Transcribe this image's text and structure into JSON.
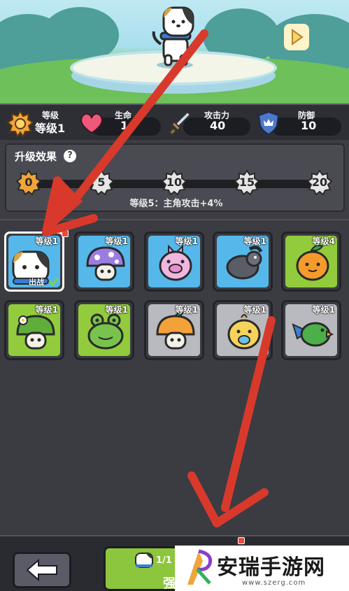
{
  "stats": {
    "level_caption": "等级",
    "level_value": "等级1",
    "hp_caption": "生命",
    "hp_value": "1",
    "attack_caption": "攻击力",
    "attack_value": "40",
    "defense_caption": "防御",
    "defense_value": "10"
  },
  "upgrade": {
    "title": "升级效果",
    "help": "?",
    "milestones": [
      "0",
      "5",
      "10",
      "15",
      "20"
    ],
    "effect_text": "等级5：主角攻击+4%"
  },
  "pets": [
    {
      "level": "等级1",
      "color": "blue",
      "selected": true,
      "deploy_label": "出战",
      "icon": "dog-icon"
    },
    {
      "level": "等级1",
      "color": "blue",
      "icon": "purple-mushroom-icon"
    },
    {
      "level": "等级1",
      "color": "blue",
      "icon": "pink-pig-icon"
    },
    {
      "level": "等级1",
      "color": "blue",
      "icon": "beetle-icon"
    },
    {
      "level": "等级4",
      "color": "green",
      "icon": "orange-icon"
    },
    {
      "level": "等级1",
      "color": "green",
      "icon": "green-sprout-icon"
    },
    {
      "level": "等级1",
      "color": "green",
      "icon": "frog-icon"
    },
    {
      "level": "等级1",
      "color": "gray",
      "icon": "orange-mushroom-icon"
    },
    {
      "level": "等级1",
      "color": "gray",
      "icon": "chick-icon"
    },
    {
      "level": "等级1",
      "color": "gray",
      "icon": "parrot-icon"
    }
  ],
  "bottom": {
    "enhance_count": "1/1",
    "enhance_label": "强"
  },
  "watermark": {
    "title": "安瑞手游网",
    "url": "www.szerg.com"
  },
  "colors": {
    "blue_card": "#56b8ea",
    "green_card": "#92cc3c",
    "gray_card": "#b9bac0",
    "arrow": "#d9392b"
  }
}
